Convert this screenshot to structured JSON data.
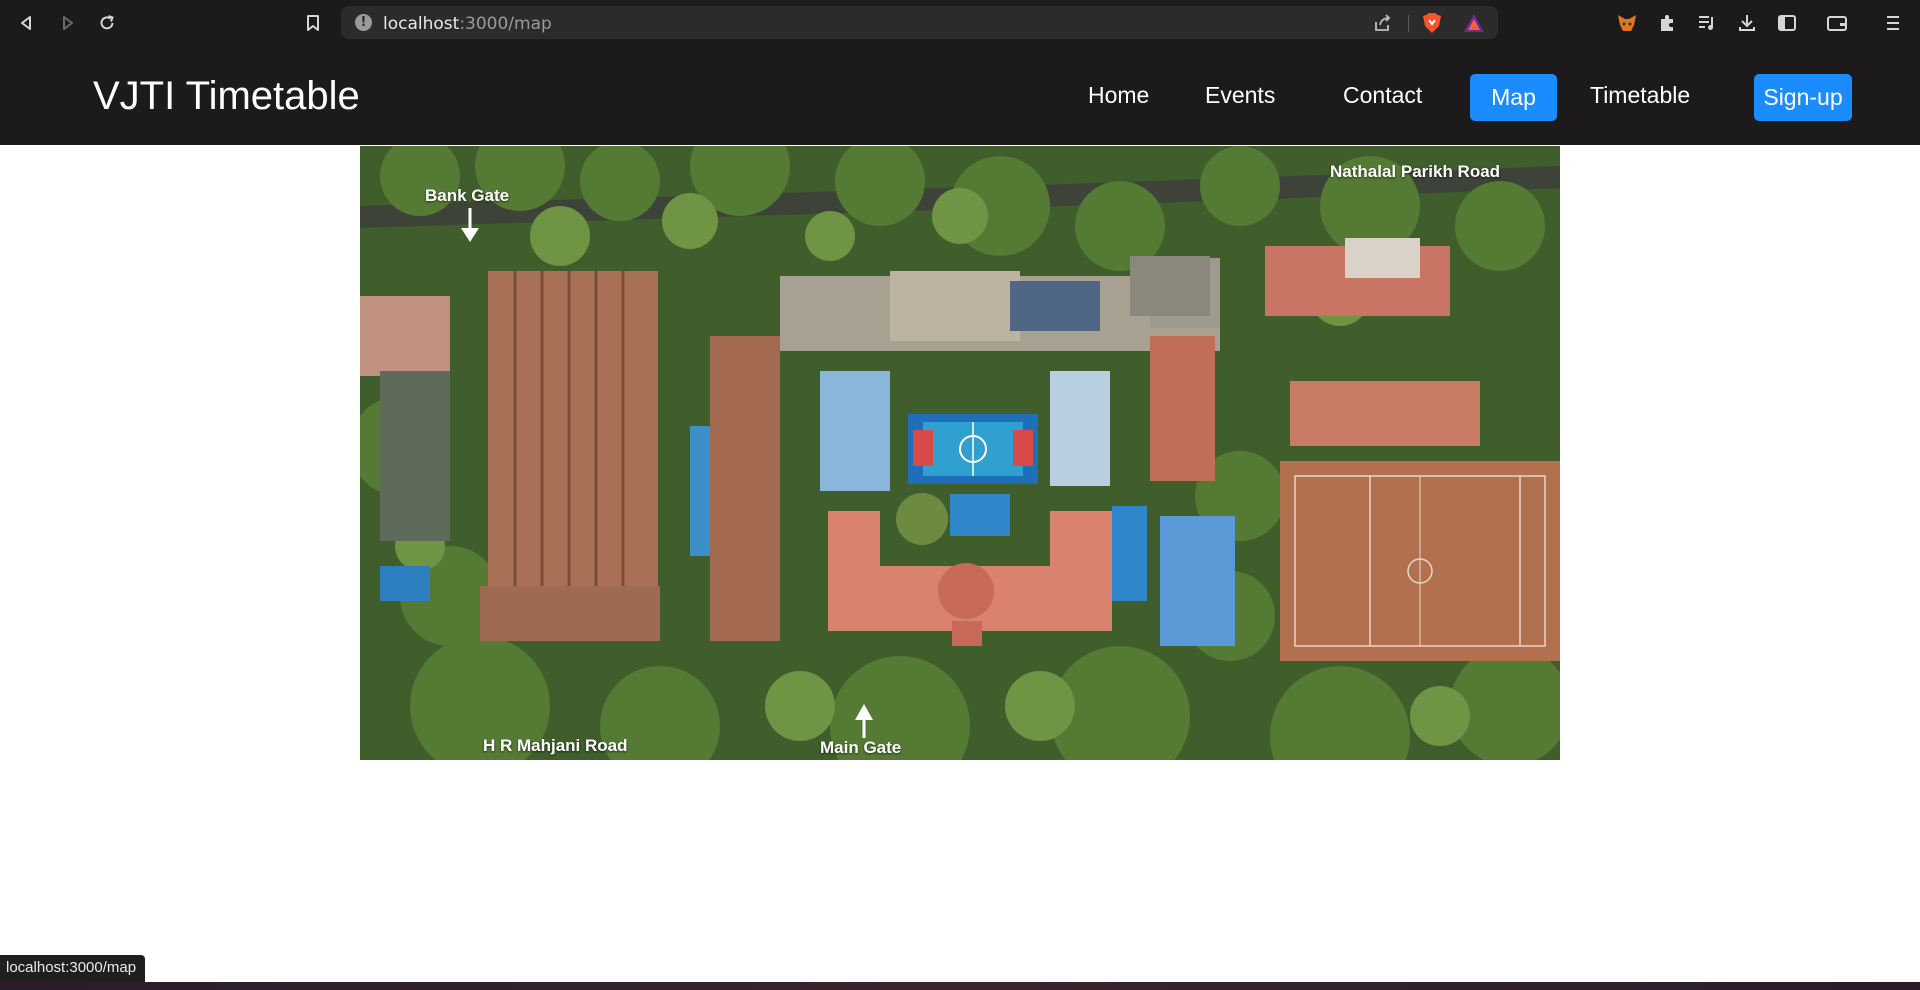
{
  "browser": {
    "url_host": "localhost",
    "url_path": ":3000/map",
    "status_text": "localhost:3000/map"
  },
  "site": {
    "brand": "VJTI Timetable",
    "nav": {
      "home": "Home",
      "events": "Events",
      "contact": "Contact",
      "map": "Map",
      "timetable": "Timetable",
      "signup": "Sign-up"
    },
    "active_nav": "Map",
    "accent_color": "#1a8cff",
    "navbar_color": "#1c1a1a"
  },
  "map": {
    "labels": {
      "bank_gate": "Bank Gate",
      "nathalal_road": "Nathalal Parikh Road",
      "hr_mahjani_road": "H R Mahjani Road",
      "main_gate": "Main Gate"
    }
  }
}
